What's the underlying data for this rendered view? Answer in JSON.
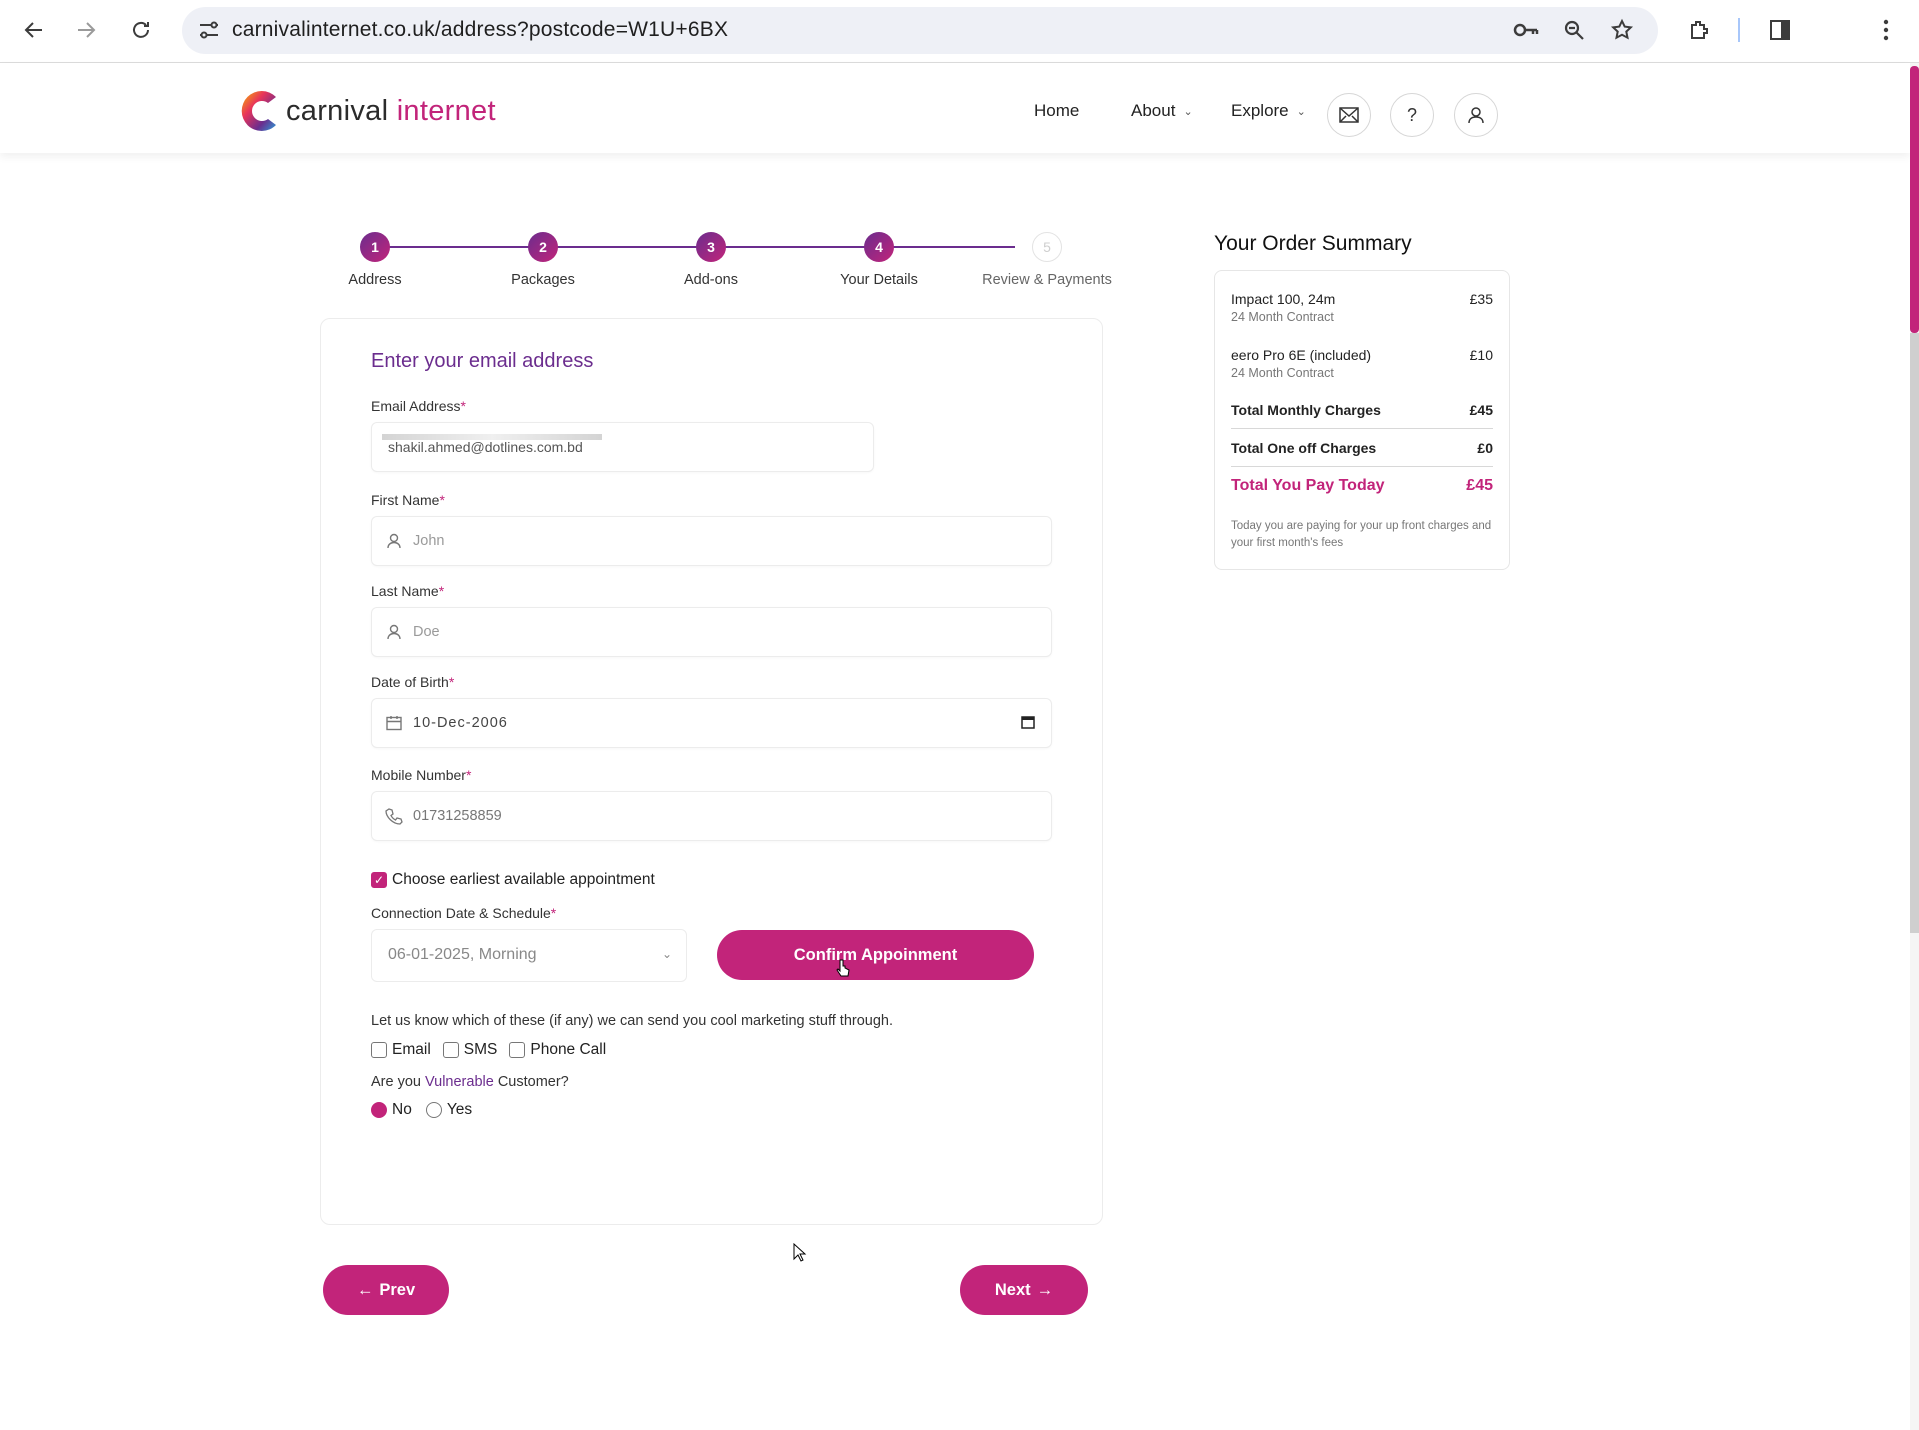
{
  "browser": {
    "url": "carnivalinternet.co.uk/address?postcode=W1U+6BX"
  },
  "header": {
    "logo_part1": "carnival",
    "logo_part2": "internet",
    "nav": {
      "home": "Home",
      "about": "About",
      "explore": "Explore"
    },
    "help_label": "?"
  },
  "stepper": {
    "steps": [
      {
        "number": "1",
        "label": "Address"
      },
      {
        "number": "2",
        "label": "Packages"
      },
      {
        "number": "3",
        "label": "Add-ons"
      },
      {
        "number": "4",
        "label": "Your Details"
      },
      {
        "number": "5",
        "label": "Review & Payments"
      }
    ]
  },
  "form": {
    "title": "Enter your email address",
    "email": {
      "label": "Email Address",
      "value": "shakil.ahmed@dotlines.com.bd"
    },
    "first_name": {
      "label": "First Name",
      "placeholder": "John"
    },
    "last_name": {
      "label": "Last Name",
      "placeholder": "Doe"
    },
    "dob": {
      "label": "Date of Birth",
      "value": "10-Dec-2006"
    },
    "mobile": {
      "label": "Mobile Number",
      "value": "01731258859"
    },
    "required_mark": "*",
    "earliest_appointment": {
      "label": "Choose earliest available appointment",
      "checked": true
    },
    "connection": {
      "label": "Connection Date & Schedule",
      "value": "06-01-2025, Morning"
    },
    "confirm_button": "Confirm Appoinment",
    "marketing": {
      "question": "Let us know which of these (if any) we can send you cool marketing stuff through.",
      "options": [
        "Email",
        "SMS",
        "Phone Call"
      ]
    },
    "vulnerable": {
      "question_pre": "Are you ",
      "question_link": "Vulnerable",
      "question_post": " Customer?",
      "options": [
        "No",
        "Yes"
      ],
      "selected": "No"
    },
    "prev_button": "Prev",
    "next_button": "Next"
  },
  "order_summary": {
    "title": "Your Order Summary",
    "items": [
      {
        "name": "Impact 100, 24m",
        "contract": "24 Month Contract",
        "price": "£35"
      },
      {
        "name": "eero Pro 6E (included)",
        "contract": "24 Month Contract",
        "price": "£10"
      }
    ],
    "total_monthly": {
      "label": "Total Monthly Charges",
      "value": "£45"
    },
    "total_one_off": {
      "label": "Total One off Charges",
      "value": "£0"
    },
    "total_today": {
      "label": "Total You Pay Today",
      "value": "£45"
    },
    "note": "Today you are paying for your up front charges and your first month's fees"
  },
  "colors": {
    "brand_pink": "#c2247a",
    "brand_purple": "#6b2d8e"
  }
}
